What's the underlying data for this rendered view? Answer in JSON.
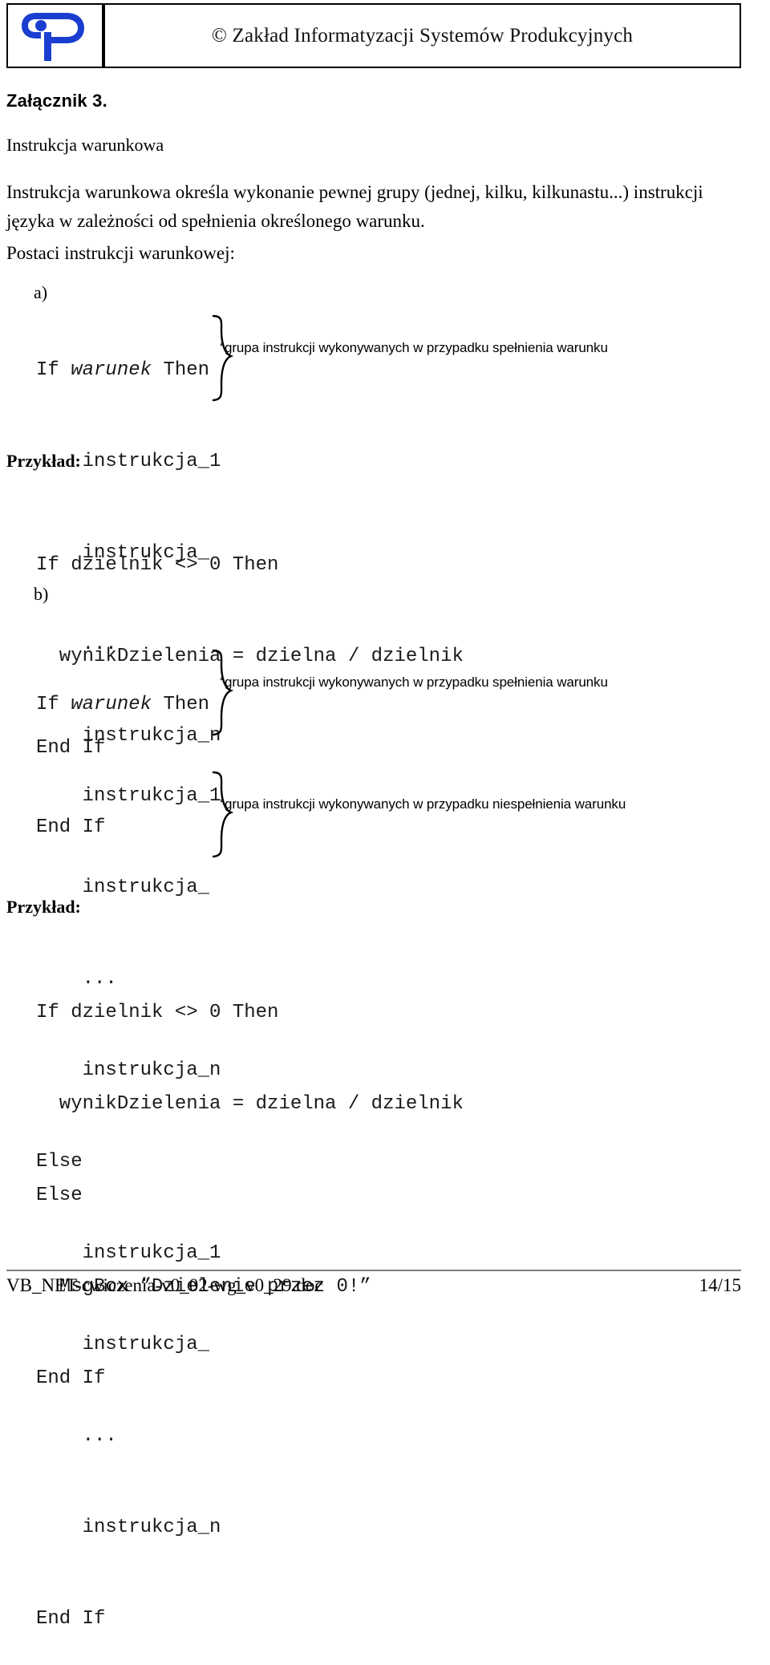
{
  "header": {
    "logo_alt": "ZIP logo",
    "copyright_line": "© Zakład Informatyzacji Systemów Produkcyjnych"
  },
  "document": {
    "appendix_heading": "Załącznik 3.",
    "section_heading": "Instrukcja warunkowa",
    "intro_paragraph": "Instrukcja warunkowa określa wykonanie pewnej grupy (jednej, kilku, kilkunastu...) instrukcji języka w zależności od spełnienia określonego warunku.",
    "forms_label": "Postaci instrukcji warunkowej:"
  },
  "form_a": {
    "marker": "a)",
    "code": {
      "line1_keyword_if": "If ",
      "line1_condition": "warunek",
      "line1_keyword_then": " Then",
      "line2": "    instrukcja_1",
      "line3": "    instrukcja_",
      "line4": "    ...",
      "line5": "    instrukcja_n",
      "line6": "End If"
    },
    "annotation_tick": "‘",
    "annotation": "grupa instrukcji wykonywanych w przypadku spełnienia warunku"
  },
  "example_a": {
    "label": "Przykład:",
    "lines": [
      "If dzielnik <> 0 Then",
      "  wynikDzielenia = dzielna / dzielnik",
      "End If"
    ]
  },
  "form_b": {
    "marker": "b)",
    "code": {
      "line1_keyword_if": "If ",
      "line1_condition": "warunek",
      "line1_keyword_then": " Then",
      "line2": "    instrukcja_1",
      "line3": "    instrukcja_",
      "line4": "    ...",
      "line5": "    instrukcja_n",
      "line6": "Else",
      "line7": "    instrukcja_1",
      "line8": "    instrukcja_",
      "line9": "    ...",
      "line10": "    instrukcja_n",
      "line11": "End If"
    },
    "annotation_tick_1": "‘",
    "annotation_1": "grupa instrukcji wykonywanych w przypadku spełnienia warunku",
    "annotation_tick_2": "‘",
    "annotation_2": "grupa instrukcji wykonywanych w przypadku niespełnienia warunku"
  },
  "example_b": {
    "label": "Przykład:",
    "lines": [
      "If dzielnik <> 0 Then",
      "  wynikDzielenia = dzielna / dzielnik",
      "Else",
      "  MsgBox ”Dzielenie przez 0!”",
      "End If"
    ]
  },
  "footer": {
    "file_name": "VB_NET-cwiczenia-v0_02-wg_v0_29.doc",
    "page_number": "14/15"
  },
  "colors": {
    "logo_blue": "#1a3fd0",
    "rule_gray": "#808080",
    "text_black": "#000000"
  }
}
